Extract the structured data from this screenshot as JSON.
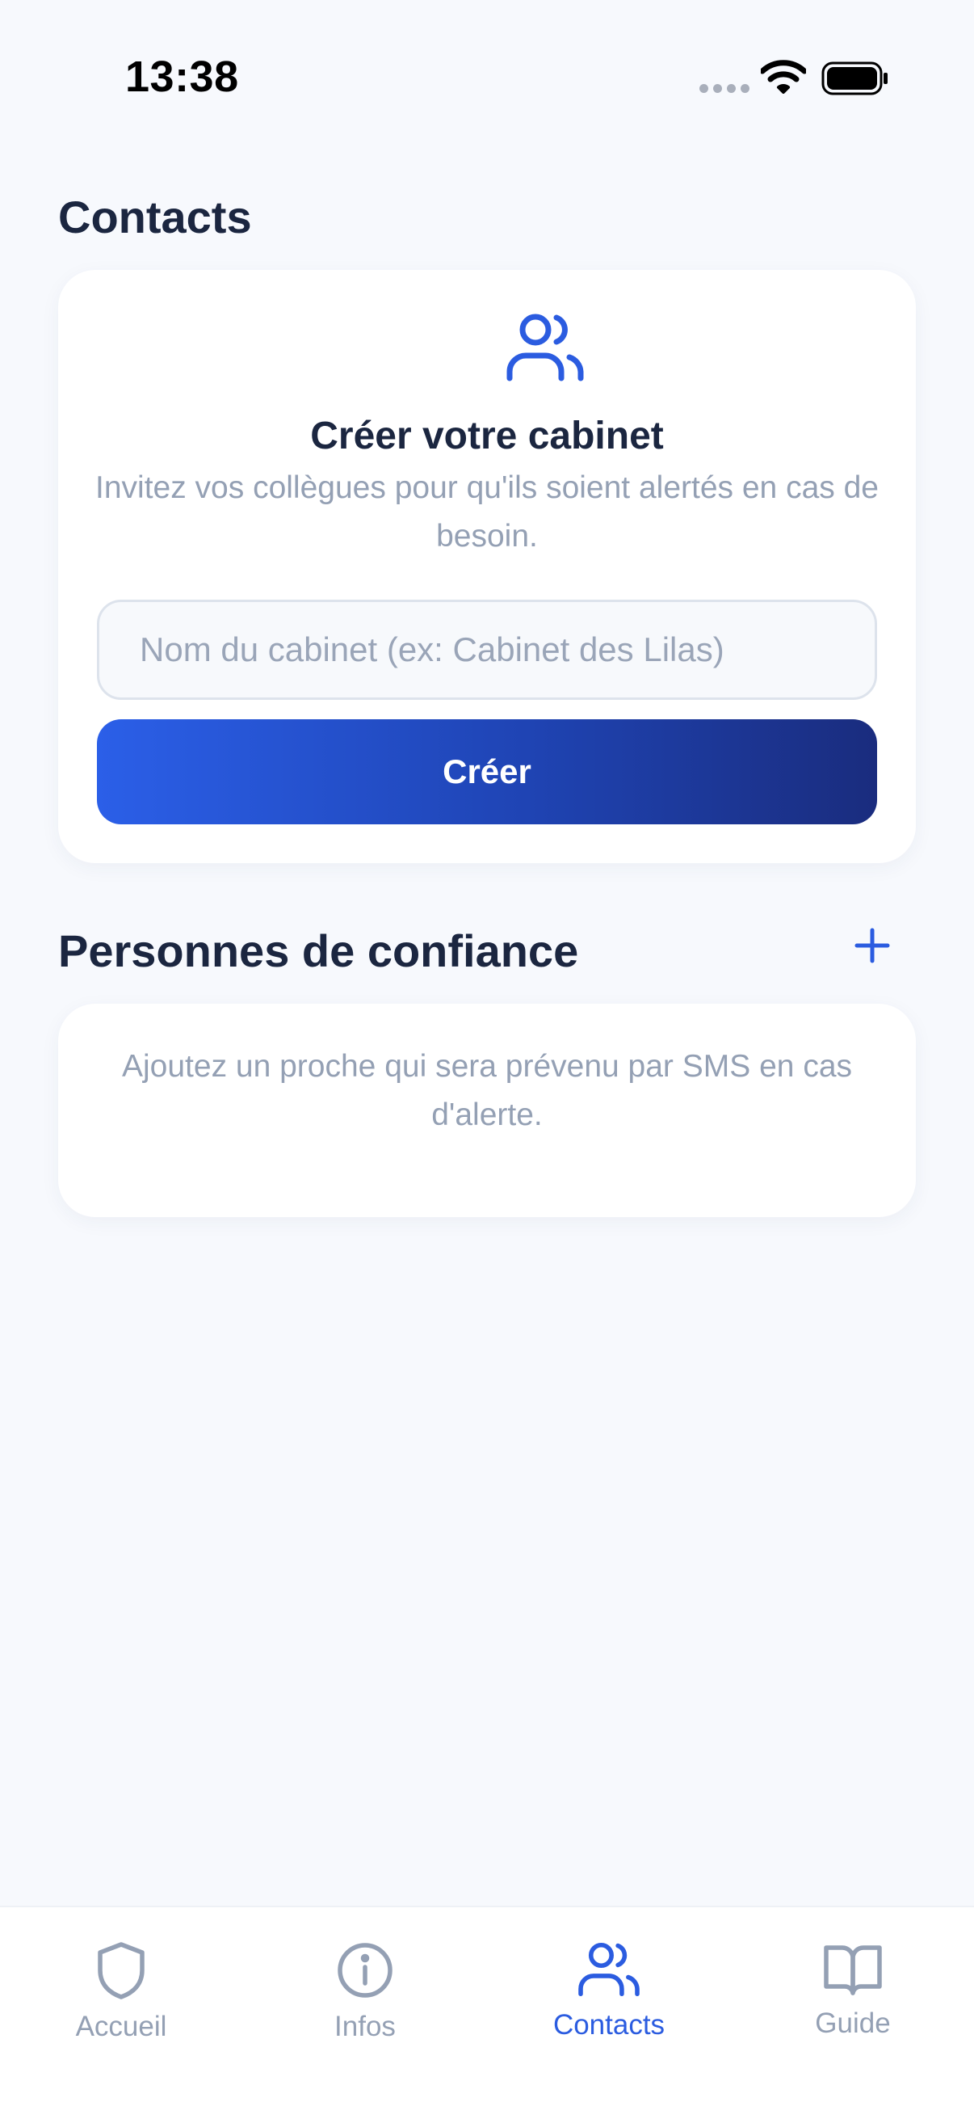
{
  "status_bar": {
    "time": "13:38"
  },
  "colors": {
    "accent": "#2B5CE0",
    "title": "#1B2640",
    "muted": "#94A0B4",
    "background": "#F7F9FD",
    "button_gradient_start": "#2B5FE8",
    "button_gradient_end": "#1A2C7E"
  },
  "contacts": {
    "title": "Contacts",
    "card": {
      "icon": "users-icon",
      "heading": "Créer votre cabinet",
      "description": "Invitez vos collègues pour qu'ils soient alertés en cas de besoin.",
      "input_placeholder": "Nom du cabinet (ex: Cabinet des Lilas)",
      "input_value": "",
      "button_label": "Créer"
    }
  },
  "trusted": {
    "title": "Personnes de confiance",
    "add_icon": "plus-icon",
    "empty_text": "Ajoutez un proche qui sera prévenu par SMS en cas d'alerte."
  },
  "tab_bar": {
    "active": "Contacts",
    "tabs": [
      {
        "label": "Accueil",
        "icon": "shield-icon"
      },
      {
        "label": "Infos",
        "icon": "info-icon"
      },
      {
        "label": "Contacts",
        "icon": "users-icon"
      },
      {
        "label": "Guide",
        "icon": "book-icon"
      }
    ]
  }
}
